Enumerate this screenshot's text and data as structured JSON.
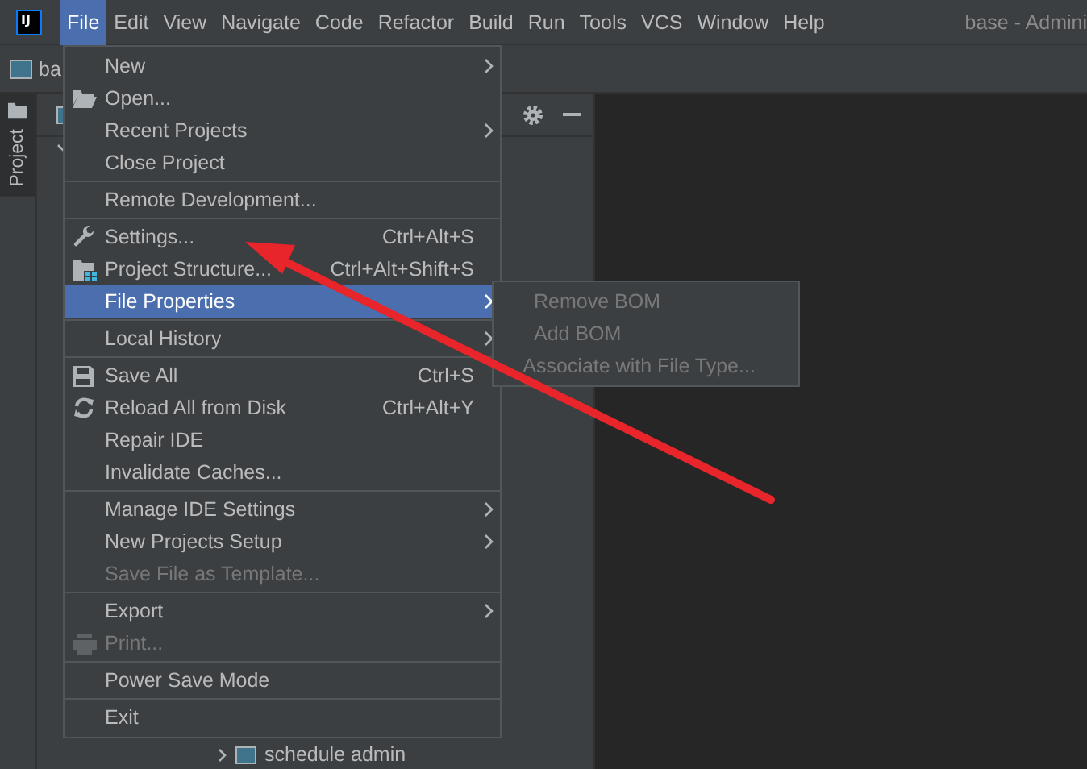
{
  "app_logo": "IJ",
  "menubar": [
    {
      "label": "File",
      "selected": true
    },
    {
      "label": "Edit",
      "selected": false
    },
    {
      "label": "View",
      "selected": false
    },
    {
      "label": "Navigate",
      "selected": false
    },
    {
      "label": "Code",
      "selected": false
    },
    {
      "label": "Refactor",
      "selected": false
    },
    {
      "label": "Build",
      "selected": false
    },
    {
      "label": "Run",
      "selected": false
    },
    {
      "label": "Tools",
      "selected": false
    },
    {
      "label": "VCS",
      "selected": false
    },
    {
      "label": "Window",
      "selected": false
    },
    {
      "label": "Help",
      "selected": false
    }
  ],
  "window_title": "base - Admini",
  "breadcrumb": "ba",
  "tool_stripe": [
    {
      "label": "Project",
      "selected": true
    }
  ],
  "project_tree": [
    {
      "label": "schedule admin"
    }
  ],
  "file_menu": [
    {
      "kind": "item",
      "label": "New",
      "submenu": true,
      "selected": false,
      "disabled": false
    },
    {
      "kind": "item",
      "label": "Open...",
      "submenu": false,
      "selected": false,
      "disabled": false
    },
    {
      "kind": "item",
      "label": "Recent Projects",
      "submenu": true,
      "selected": false,
      "disabled": false
    },
    {
      "kind": "item",
      "label": "Close Project",
      "submenu": false,
      "selected": false,
      "disabled": false
    },
    {
      "kind": "separator"
    },
    {
      "kind": "item",
      "label": "Remote Development...",
      "submenu": false,
      "selected": false,
      "disabled": false
    },
    {
      "kind": "separator"
    },
    {
      "kind": "item",
      "label": "Settings...",
      "shortcut": "Ctrl+Alt+S",
      "submenu": false,
      "selected": false,
      "disabled": false
    },
    {
      "kind": "item",
      "label": "Project Structure...",
      "shortcut": "Ctrl+Alt+Shift+S",
      "submenu": false,
      "selected": false,
      "disabled": false
    },
    {
      "kind": "item",
      "label": "File Properties",
      "submenu": true,
      "selected": true,
      "disabled": false
    },
    {
      "kind": "separator"
    },
    {
      "kind": "item",
      "label": "Local History",
      "submenu": true,
      "selected": false,
      "disabled": false
    },
    {
      "kind": "separator"
    },
    {
      "kind": "item",
      "label": "Save All",
      "shortcut": "Ctrl+S",
      "submenu": false,
      "selected": false,
      "disabled": false
    },
    {
      "kind": "item",
      "label": "Reload All from Disk",
      "shortcut": "Ctrl+Alt+Y",
      "submenu": false,
      "selected": false,
      "disabled": false
    },
    {
      "kind": "item",
      "label": "Repair IDE",
      "submenu": false,
      "selected": false,
      "disabled": false
    },
    {
      "kind": "item",
      "label": "Invalidate Caches...",
      "submenu": false,
      "selected": false,
      "disabled": false
    },
    {
      "kind": "separator"
    },
    {
      "kind": "item",
      "label": "Manage IDE Settings",
      "submenu": true,
      "selected": false,
      "disabled": false
    },
    {
      "kind": "item",
      "label": "New Projects Setup",
      "submenu": true,
      "selected": false,
      "disabled": false
    },
    {
      "kind": "item",
      "label": "Save File as Template...",
      "submenu": false,
      "selected": false,
      "disabled": true
    },
    {
      "kind": "separator"
    },
    {
      "kind": "item",
      "label": "Export",
      "submenu": true,
      "selected": false,
      "disabled": false
    },
    {
      "kind": "item",
      "label": "Print...",
      "submenu": false,
      "selected": false,
      "disabled": true
    },
    {
      "kind": "separator"
    },
    {
      "kind": "item",
      "label": "Power Save Mode",
      "submenu": false,
      "selected": false,
      "disabled": false
    },
    {
      "kind": "separator"
    },
    {
      "kind": "item",
      "label": "Exit",
      "submenu": false,
      "selected": false,
      "disabled": false
    }
  ],
  "file_properties_submenu": [
    {
      "kind": "item",
      "label": "Remove BOM",
      "submenu": false,
      "selected": false,
      "disabled": true
    },
    {
      "kind": "item",
      "label": "Add BOM",
      "submenu": false,
      "selected": false,
      "disabled": true
    },
    {
      "kind": "item",
      "label": "Associate with File Type...",
      "submenu": false,
      "selected": false,
      "disabled": true
    }
  ]
}
